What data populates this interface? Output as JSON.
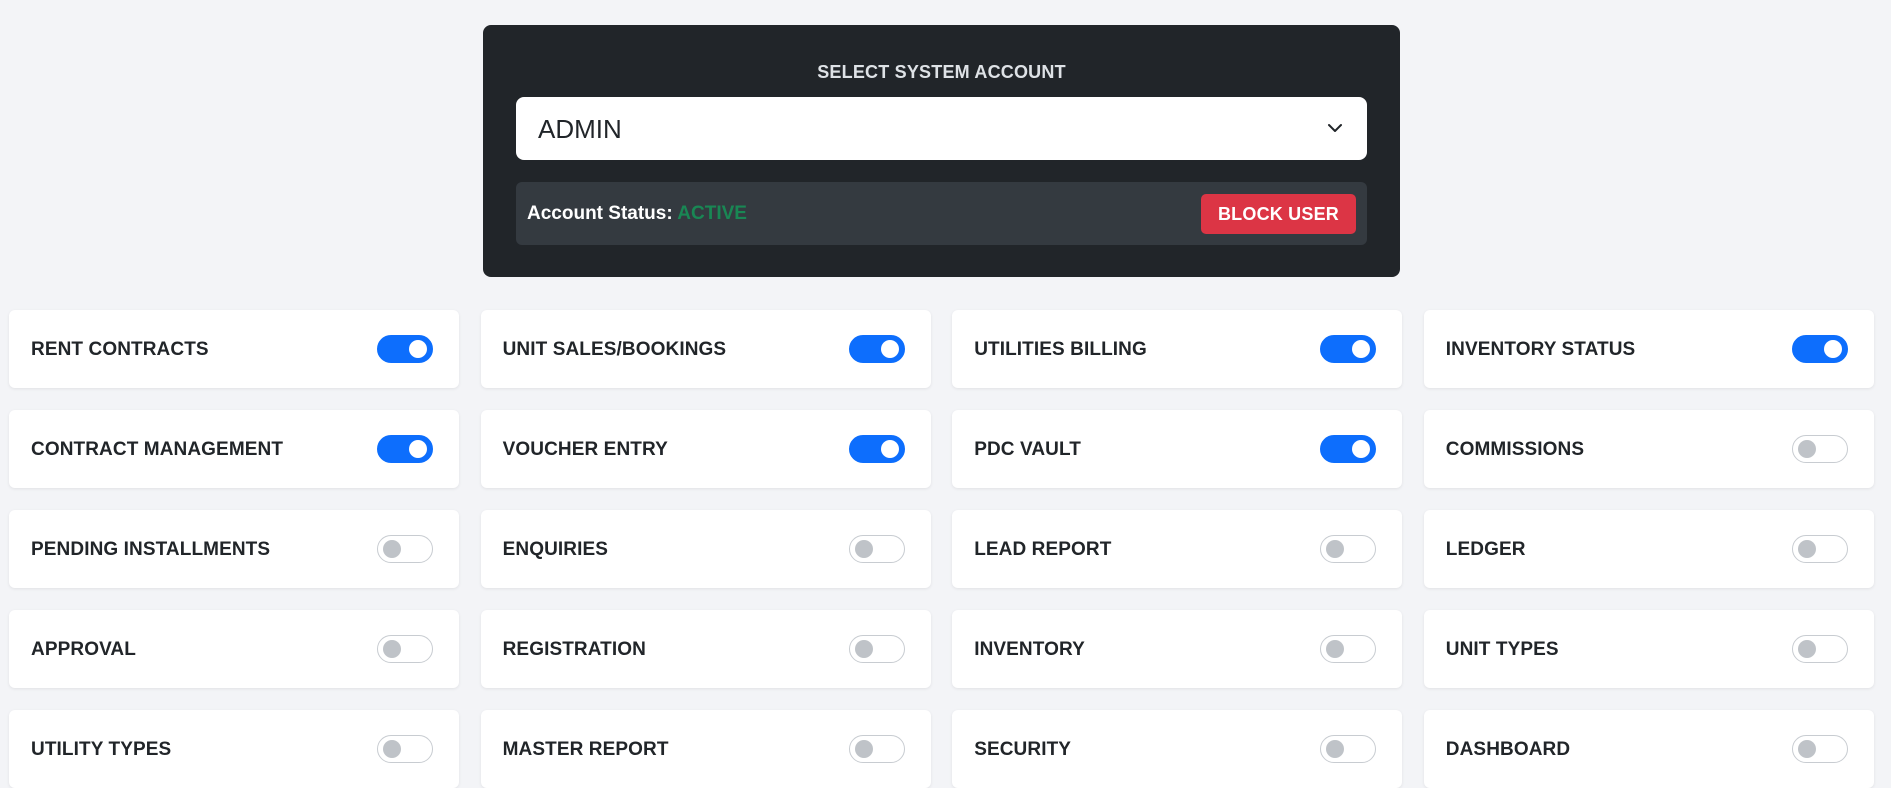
{
  "account": {
    "title": "SELECT SYSTEM ACCOUNT",
    "selected": "ADMIN",
    "status_label": "Account Status:",
    "status_value": "ACTIVE",
    "block_button": "BLOCK USER",
    "colors": {
      "panel": "#212529",
      "active": "#198754",
      "block": "#dc3545"
    }
  },
  "permissions": [
    {
      "label": "RENT CONTRACTS",
      "enabled": true
    },
    {
      "label": "UNIT SALES/BOOKINGS",
      "enabled": true
    },
    {
      "label": "UTILITIES BILLING",
      "enabled": true
    },
    {
      "label": "INVENTORY STATUS",
      "enabled": true
    },
    {
      "label": "CONTRACT MANAGEMENT",
      "enabled": true
    },
    {
      "label": "VOUCHER ENTRY",
      "enabled": true
    },
    {
      "label": "PDC VAULT",
      "enabled": true
    },
    {
      "label": "COMMISSIONS",
      "enabled": false
    },
    {
      "label": "PENDING INSTALLMENTS",
      "enabled": false
    },
    {
      "label": "ENQUIRIES",
      "enabled": false
    },
    {
      "label": "LEAD REPORT",
      "enabled": false
    },
    {
      "label": "LEDGER",
      "enabled": false
    },
    {
      "label": "APPROVAL",
      "enabled": false
    },
    {
      "label": "REGISTRATION",
      "enabled": false
    },
    {
      "label": "INVENTORY",
      "enabled": false
    },
    {
      "label": "UNIT TYPES",
      "enabled": false
    },
    {
      "label": "UTILITY TYPES",
      "enabled": false
    },
    {
      "label": "MASTER REPORT",
      "enabled": false
    },
    {
      "label": "SECURITY",
      "enabled": false
    },
    {
      "label": "DASHBOARD",
      "enabled": false
    }
  ],
  "toggle_colors": {
    "on": "#0d6efd",
    "off": "#bfc3c8"
  }
}
